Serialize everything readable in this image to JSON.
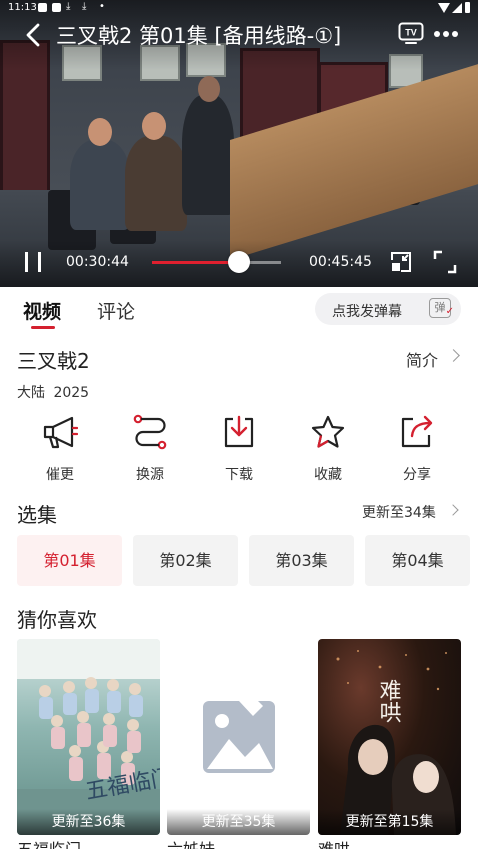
{
  "status_bar": {
    "time": "11:13"
  },
  "player": {
    "title": "三叉戟2 第01集 [备用线路-①]",
    "tv_label": "TV",
    "current_time": "00:30:44",
    "total_time": "00:45:45",
    "progress": 0.672
  },
  "tabs": [
    {
      "label": "视频",
      "active": true
    },
    {
      "label": "评论",
      "active": false
    }
  ],
  "danmaku": {
    "placeholder": "点我发弹幕",
    "icon_text": "弹"
  },
  "show": {
    "title": "三叉戟2",
    "intro_label": "简介",
    "meta": "大陆  2025"
  },
  "actions": [
    {
      "label": "催更",
      "icon": "megaphone-icon"
    },
    {
      "label": "换源",
      "icon": "switch-source-icon"
    },
    {
      "label": "下载",
      "icon": "download-icon"
    },
    {
      "label": "收藏",
      "icon": "star-icon"
    },
    {
      "label": "分享",
      "icon": "share-icon"
    }
  ],
  "episodes": {
    "section_title": "选集",
    "update_text": "更新至34集",
    "items": [
      {
        "label": "第01集",
        "active": true
      },
      {
        "label": "第02集",
        "active": false
      },
      {
        "label": "第03集",
        "active": false
      },
      {
        "label": "第04集",
        "active": false
      }
    ]
  },
  "recommend": {
    "section_title": "猜你喜欢",
    "items": [
      {
        "badge": "更新至36集",
        "name": "五福临门"
      },
      {
        "badge": "更新至35集",
        "name": "六姊妹"
      },
      {
        "badge": "更新至第15集",
        "name": "难哄"
      }
    ],
    "poster_text_1": "五福临门",
    "poster_text_3": "难哄"
  },
  "colors": {
    "accent": "#d4202f",
    "progress": "#e0202f"
  }
}
